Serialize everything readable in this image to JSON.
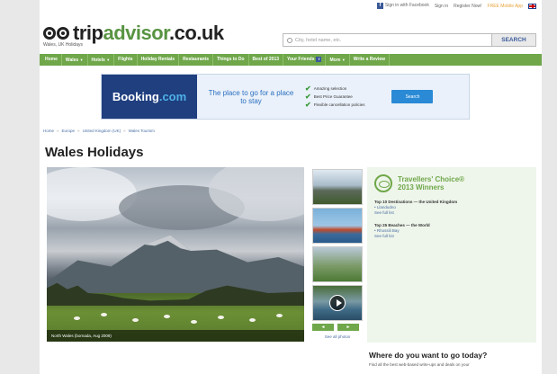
{
  "topbar": {
    "facebook_link": "Sign in with Facebook",
    "sign_in": "Sign in",
    "register": "Register Now!",
    "mobile_app": "FREE Mobile App"
  },
  "logo": {
    "name_dark": "trip",
    "name_green": "advisor",
    "suffix": ".co.uk",
    "subtitle": "Wales, UK Holidays"
  },
  "search": {
    "placeholder": "City, hotel name, etc.",
    "button": "SEARCH"
  },
  "nav": {
    "items": [
      "Home",
      "Wales",
      "Hotels",
      "Flights",
      "Holiday Rentals",
      "Restaurants",
      "Things to Do",
      "Best of 2013",
      "Your Friends",
      "More",
      "Write a Review"
    ]
  },
  "ad": {
    "brand": "Booking",
    "brand_suffix": ".com",
    "tagline": "The place to go for a place to stay",
    "checks": [
      "Amazing selection",
      "Best Price Guarantee",
      "Flexible cancellation policies"
    ],
    "button": "Search"
  },
  "breadcrumb": [
    "Home",
    "Europe",
    "United Kingdom (UK)",
    "Wales Tourism"
  ],
  "page_title": "Wales Holidays",
  "hero": {
    "caption": "North Wales (bornada, Aug 2009)"
  },
  "thumbs": {
    "see_all": "See all photos",
    "prev": "◄",
    "next": "►"
  },
  "travellers_choice": {
    "title_line1": "Travellers' Choice®",
    "title_line2": "2013 Winners",
    "block1_heading": "Top 10 Destinations — the United Kingdom",
    "block1_item": "• Llandudno",
    "block1_link": "See full list",
    "block2_heading": "Top 25 Beaches — the World",
    "block2_item": "• Rhossili Bay",
    "block2_link": "See full list"
  },
  "where": {
    "title": "Where do you want to go today?",
    "text": "Find all the best web-based write-ups and deals on your"
  },
  "colors": {
    "brand_green": "#6fa74a",
    "link_blue": "#4a6fa5",
    "booking_navy": "#1f3f7f"
  }
}
